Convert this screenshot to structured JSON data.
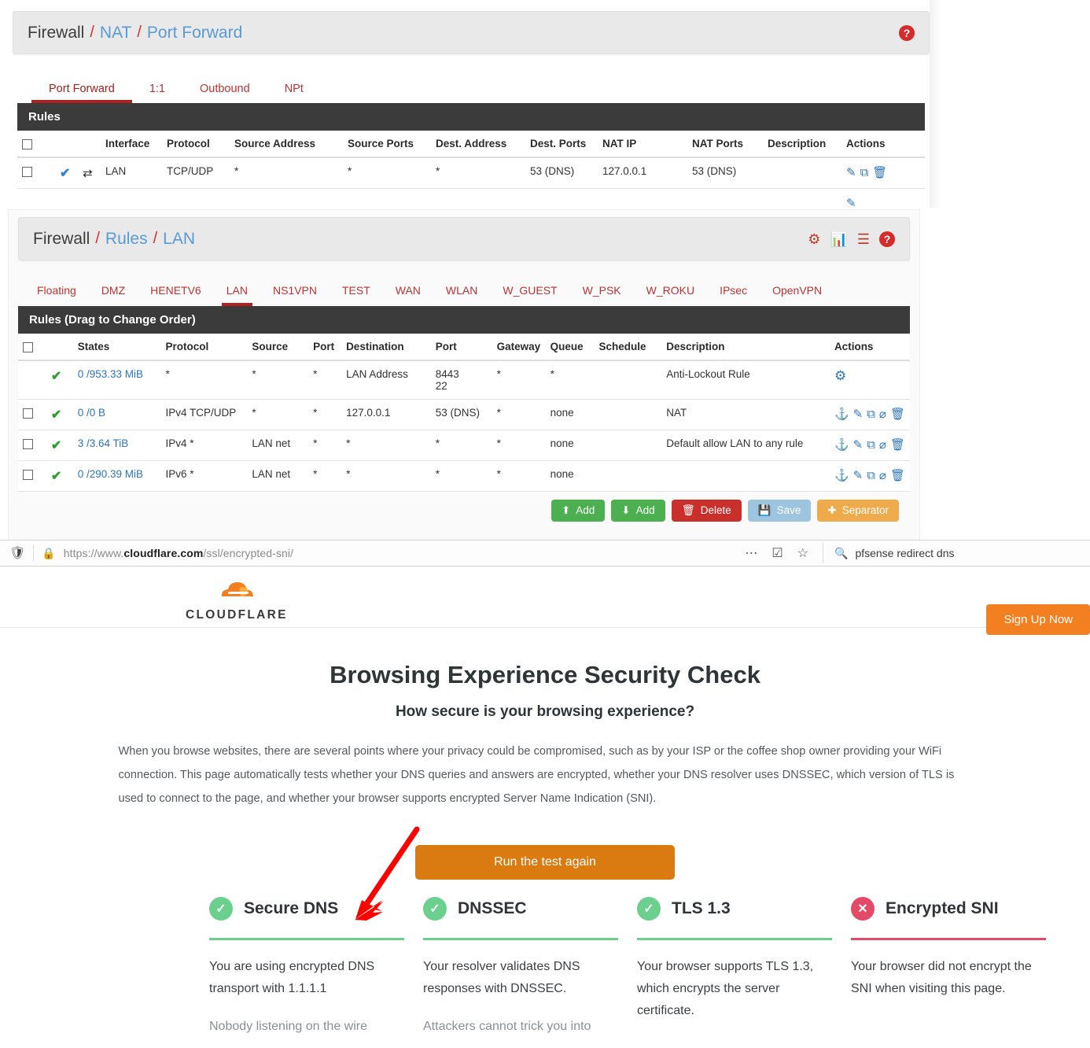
{
  "pfsense": {
    "nat_panel": {
      "breadcrumb": {
        "root": "Firewall",
        "mid": "NAT",
        "leaf": "Port Forward",
        "sep": "/"
      },
      "help_icon": "?",
      "tabs": [
        {
          "label": "Port Forward",
          "active": true
        },
        {
          "label": "1:1",
          "active": false
        },
        {
          "label": "Outbound",
          "active": false
        },
        {
          "label": "NPt",
          "active": false
        }
      ],
      "table_title": "Rules",
      "columns": [
        "",
        "Interface",
        "Protocol",
        "Source Address",
        "Source Ports",
        "Dest. Address",
        "Dest. Ports",
        "NAT IP",
        "NAT Ports",
        "Description",
        "Actions"
      ],
      "rows": [
        {
          "interface": "LAN",
          "protocol": "TCP/UDP",
          "source_address": "*",
          "source_ports": "*",
          "dest_address": "*",
          "dest_ports": "53 (DNS)",
          "nat_ip": "127.0.0.1",
          "nat_ports": "53 (DNS)",
          "description": ""
        }
      ]
    },
    "rules_panel": {
      "breadcrumb": {
        "root": "Firewall",
        "mid": "Rules",
        "leaf": "LAN",
        "sep": "/"
      },
      "header_icons": [
        "sliders-icon",
        "bar-chart-icon",
        "log-icon",
        "help-icon"
      ],
      "tabs": [
        {
          "label": "Floating",
          "active": false
        },
        {
          "label": "DMZ",
          "active": false
        },
        {
          "label": "HENETV6",
          "active": false
        },
        {
          "label": "LAN",
          "active": true
        },
        {
          "label": "NS1VPN",
          "active": false
        },
        {
          "label": "TEST",
          "active": false
        },
        {
          "label": "WAN",
          "active": false
        },
        {
          "label": "WLAN",
          "active": false
        },
        {
          "label": "W_GUEST",
          "active": false
        },
        {
          "label": "W_PSK",
          "active": false
        },
        {
          "label": "W_ROKU",
          "active": false
        },
        {
          "label": "IPsec",
          "active": false
        },
        {
          "label": "OpenVPN",
          "active": false
        }
      ],
      "table_title": "Rules (Drag to Change Order)",
      "columns": [
        "",
        "States",
        "Protocol",
        "Source",
        "Port",
        "Destination",
        "Port",
        "Gateway",
        "Queue",
        "Schedule",
        "Description",
        "Actions"
      ],
      "rows": [
        {
          "has_checkbox": false,
          "states": "0 /953.33 MiB",
          "protocol": "*",
          "source": "*",
          "port": "*",
          "destination": "LAN Address",
          "dest_port": "8443\n22",
          "gateway": "*",
          "queue": "*",
          "schedule": "",
          "description": "Anti-Lockout Rule",
          "actions": "gear"
        },
        {
          "has_checkbox": true,
          "states": "0 /0 B",
          "protocol": "IPv4 TCP/UDP",
          "source": "*",
          "port": "*",
          "destination": "127.0.0.1",
          "dest_port": "53 (DNS)",
          "gateway": "*",
          "queue": "none",
          "schedule": "",
          "description": "NAT",
          "actions": "full"
        },
        {
          "has_checkbox": true,
          "states": "3 /3.64 TiB",
          "protocol": "IPv4 *",
          "source": "LAN net",
          "port": "*",
          "destination": "*",
          "dest_port": "*",
          "gateway": "*",
          "queue": "none",
          "schedule": "",
          "description": "Default allow LAN to any rule",
          "actions": "full"
        },
        {
          "has_checkbox": true,
          "states": "0 /290.39 MiB",
          "protocol": "IPv6 *",
          "source": "LAN net",
          "port": "*",
          "destination": "*",
          "dest_port": "*",
          "gateway": "*",
          "queue": "none",
          "schedule": "",
          "description": "",
          "actions": "full"
        }
      ],
      "buttons": [
        {
          "label": "Add",
          "icon": "arrow-up-icon",
          "color": "#4caf50"
        },
        {
          "label": "Add",
          "icon": "arrow-down-icon",
          "color": "#4caf50"
        },
        {
          "label": "Delete",
          "icon": "trash-icon",
          "color": "#c9302c"
        },
        {
          "label": "Save",
          "icon": "save-icon",
          "color": "#9ec5e0"
        },
        {
          "label": "Separator",
          "icon": "plus-icon",
          "color": "#efab4b"
        }
      ]
    }
  },
  "browser": {
    "shield_icon": "shield-icon",
    "lock_icon": "lock-icon",
    "url_prefix": "https://www.",
    "url_domain": "cloudflare.com",
    "url_path": "/ssl/encrypted-sni/",
    "more_icon": "ellipsis-icon",
    "pocket_icon": "pocket-icon",
    "bookmark_icon": "star-icon",
    "search_icon": "search-icon",
    "search_value": "pfsense redirect dns"
  },
  "cloudflare": {
    "logo_text": "CLOUDFLARE",
    "signup_label": "Sign Up Now",
    "heading": "Browsing Experience Security Check",
    "subheading": "How secure is your browsing experience?",
    "paragraph": "When you browse websites, there are several points where your privacy could be compromised, such as by your ISP or the coffee shop owner providing your WiFi connection. This page automatically tests whether your DNS queries and answers are encrypted, whether your DNS resolver uses DNSSEC, which version of TLS is used to connect to the page, and whether your browser supports encrypted Server Name Indication (SNI).",
    "run_button": "Run the test again",
    "cards": [
      {
        "title": "Secure DNS",
        "status": "ok",
        "badge_icon": "check-circle-icon",
        "body": "You are using encrypted DNS transport with 1.1.1.1",
        "sub": "Nobody listening on the wire"
      },
      {
        "title": "DNSSEC",
        "status": "ok",
        "badge_icon": "check-circle-icon",
        "body": "Your resolver validates DNS responses with DNSSEC.",
        "sub": "Attackers cannot trick you into"
      },
      {
        "title": "TLS 1.3",
        "status": "ok",
        "badge_icon": "check-circle-icon",
        "body": "Your browser supports TLS 1.3, which encrypts the server certificate.",
        "sub": ""
      },
      {
        "title": "Encrypted SNI",
        "status": "bad",
        "badge_icon": "x-circle-icon",
        "body": "Your browser did not encrypt the SNI when visiting this page.",
        "sub": ""
      }
    ]
  },
  "annotation": {
    "arrow_color": "#ff0000",
    "arrow_name": "red-pointer-arrow"
  }
}
